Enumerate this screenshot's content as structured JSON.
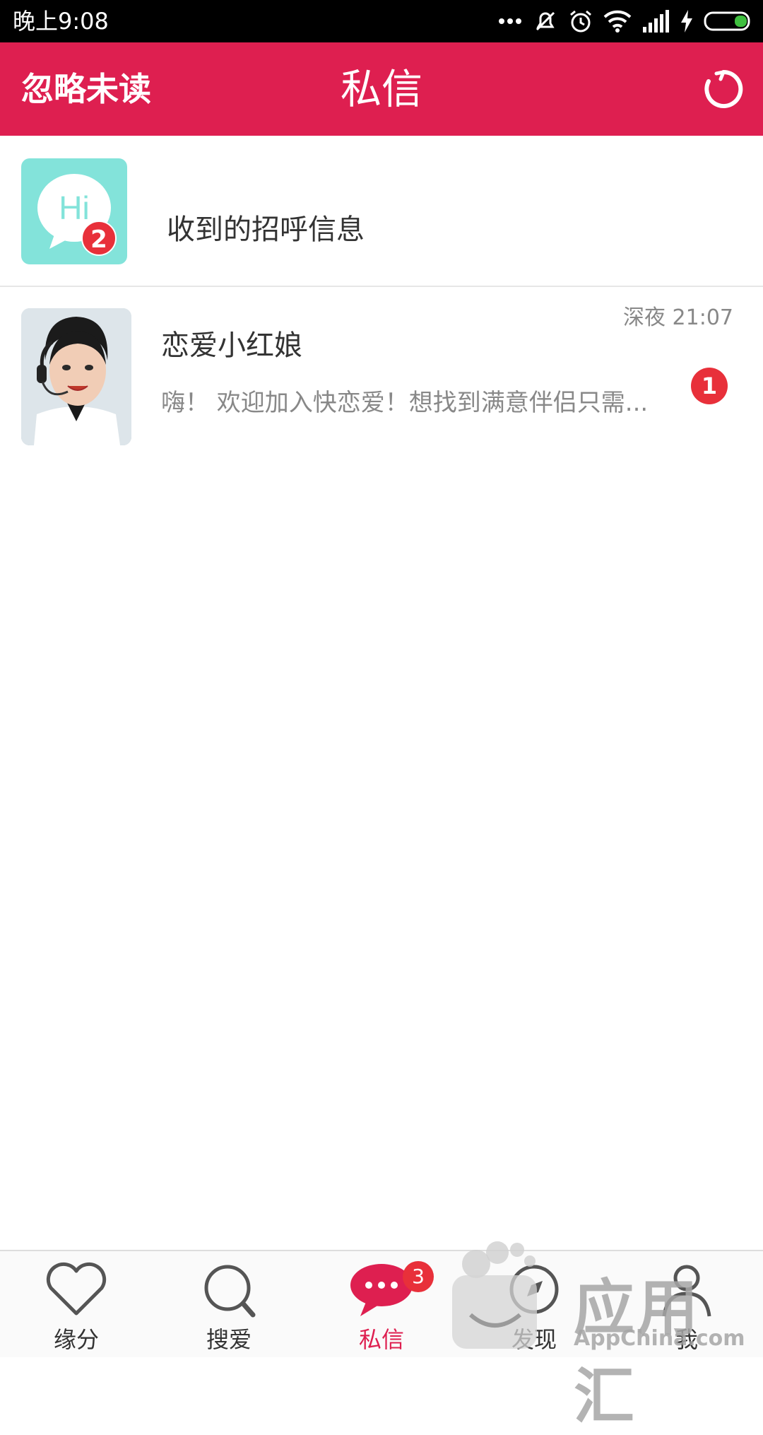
{
  "status_bar": {
    "time": "晚上9:08",
    "battery_color": "#3fbf3f"
  },
  "header": {
    "left_action": "忽略未读",
    "title": "私信",
    "right_icon": "refresh-icon",
    "background_color": "#de1f50"
  },
  "greetings": {
    "avatar_text": "Hi",
    "badge": "2",
    "label": "收到的招呼信息"
  },
  "conversations": [
    {
      "name": "恋爱小红娘",
      "time": "深夜 21:07",
      "preview": "嗨！ 欢迎加入快恋爱！想找到满意伴侣只需...",
      "unread": "1"
    }
  ],
  "bottom_nav": [
    {
      "label": "缘分",
      "icon": "heart-icon"
    },
    {
      "label": "搜爱",
      "icon": "search-icon"
    },
    {
      "label": "私信",
      "icon": "chat-bubble-icon",
      "badge": "3",
      "active": true
    },
    {
      "label": "发现",
      "icon": "compass-icon"
    },
    {
      "label": "我",
      "icon": "person-icon"
    }
  ],
  "watermark": {
    "text": "应用汇",
    "subtext": "AppChina.com"
  }
}
